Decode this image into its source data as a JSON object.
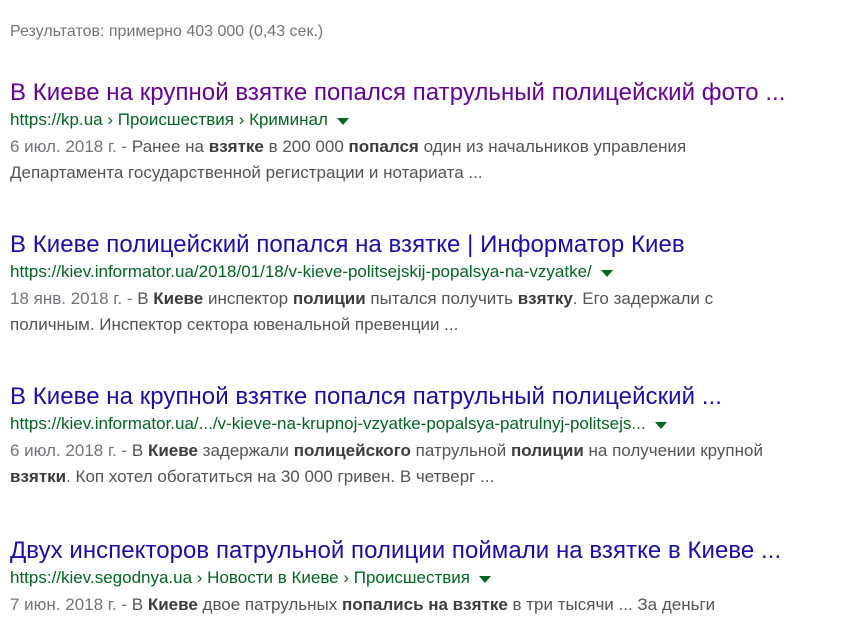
{
  "stats": "Результатов: примерно 403 000 (0,43 сек.)",
  "results": [
    {
      "title": "В Киеве на крупной взятке попался патрульный полицейский фото ...",
      "visited": true,
      "url": "https://kp.ua › Происшествия › Криминал",
      "lines": [
        [
          {
            "t": "6 июл. 2018 г. - ",
            "c": "date"
          },
          {
            "t": "Ранее на "
          },
          {
            "t": "взятке",
            "b": true
          },
          {
            "t": " в 200 000 "
          },
          {
            "t": "попался",
            "b": true
          },
          {
            "t": " один из начальников управления"
          }
        ],
        [
          {
            "t": "Департамента государственной регистрации и нотариата ..."
          }
        ]
      ]
    },
    {
      "title": "В Киеве полицейский попался на взятке | Информатор Киев",
      "visited": false,
      "url": "https://kiev.informator.ua/2018/01/18/v-kieve-politsejskij-popalsya-na-vzyatke/",
      "lines": [
        [
          {
            "t": "18 янв. 2018 г. - ",
            "c": "date"
          },
          {
            "t": "В "
          },
          {
            "t": "Киеве",
            "b": true
          },
          {
            "t": " инспектор "
          },
          {
            "t": "полиции",
            "b": true
          },
          {
            "t": " пытался получить "
          },
          {
            "t": "взятку",
            "b": true
          },
          {
            "t": ". Его задержали с"
          }
        ],
        [
          {
            "t": "поличным. Инспектор сектора ювенальной превенции ..."
          }
        ]
      ]
    },
    {
      "title": "В Киеве на крупной взятке попался патрульный полицейский ...",
      "visited": false,
      "url": "https://kiev.informator.ua/.../v-kieve-na-krupnoj-vzyatke-popalsya-patrulnyj-politsejs...",
      "lines": [
        [
          {
            "t": "6 июл. 2018 г. - ",
            "c": "date"
          },
          {
            "t": "В "
          },
          {
            "t": "Киеве",
            "b": true
          },
          {
            "t": " задержали "
          },
          {
            "t": "полицейского",
            "b": true
          },
          {
            "t": " патрульной "
          },
          {
            "t": "полиции",
            "b": true
          },
          {
            "t": " на получении крупной"
          }
        ],
        [
          {
            "t": "взятки",
            "b": true
          },
          {
            "t": ". Коп хотел обогатиться на 30 000 гривен. В четверг ..."
          }
        ]
      ]
    },
    {
      "title": "Двух инспекторов патрульной полиции поймали на взятке в Киеве ...",
      "visited": false,
      "url": "https://kiev.segodnya.ua › Новости в Киеве › Происшествия",
      "lines": [
        [
          {
            "t": "7 июн. 2018 г. - ",
            "c": "date"
          },
          {
            "t": "В "
          },
          {
            "t": "Киеве",
            "b": true
          },
          {
            "t": " двое патрульных "
          },
          {
            "t": "попались на взятке",
            "b": true
          },
          {
            "t": " в три тысячи ... За деньги"
          }
        ]
      ]
    }
  ]
}
